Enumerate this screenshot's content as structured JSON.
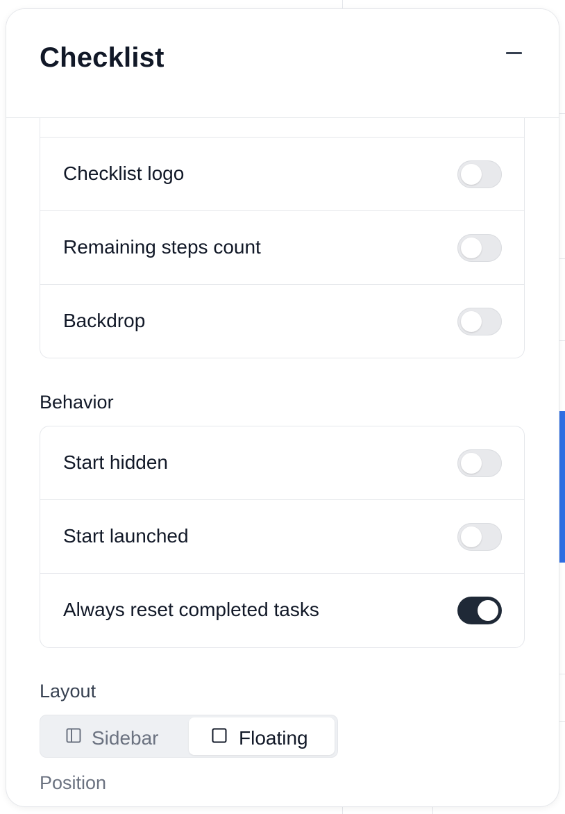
{
  "panel": {
    "title": "Checklist"
  },
  "appearance": {
    "items": [
      {
        "label": "Checklist logo",
        "enabled": false
      },
      {
        "label": "Remaining steps count",
        "enabled": false
      },
      {
        "label": "Backdrop",
        "enabled": false
      }
    ]
  },
  "behavior": {
    "heading": "Behavior",
    "items": [
      {
        "label": "Start hidden",
        "enabled": false
      },
      {
        "label": "Start launched",
        "enabled": false
      },
      {
        "label": "Always reset completed tasks",
        "enabled": true
      }
    ]
  },
  "layout": {
    "heading": "Layout",
    "options": [
      {
        "label": "Sidebar",
        "icon": "sidebar-layout-icon",
        "selected": false
      },
      {
        "label": "Floating",
        "icon": "square-icon",
        "selected": true
      }
    ]
  },
  "position": {
    "heading": "Position"
  },
  "colors": {
    "toggle_on": "#1f2937",
    "toggle_off": "#e8e9ec",
    "background_accent": "#2f6fe4"
  }
}
